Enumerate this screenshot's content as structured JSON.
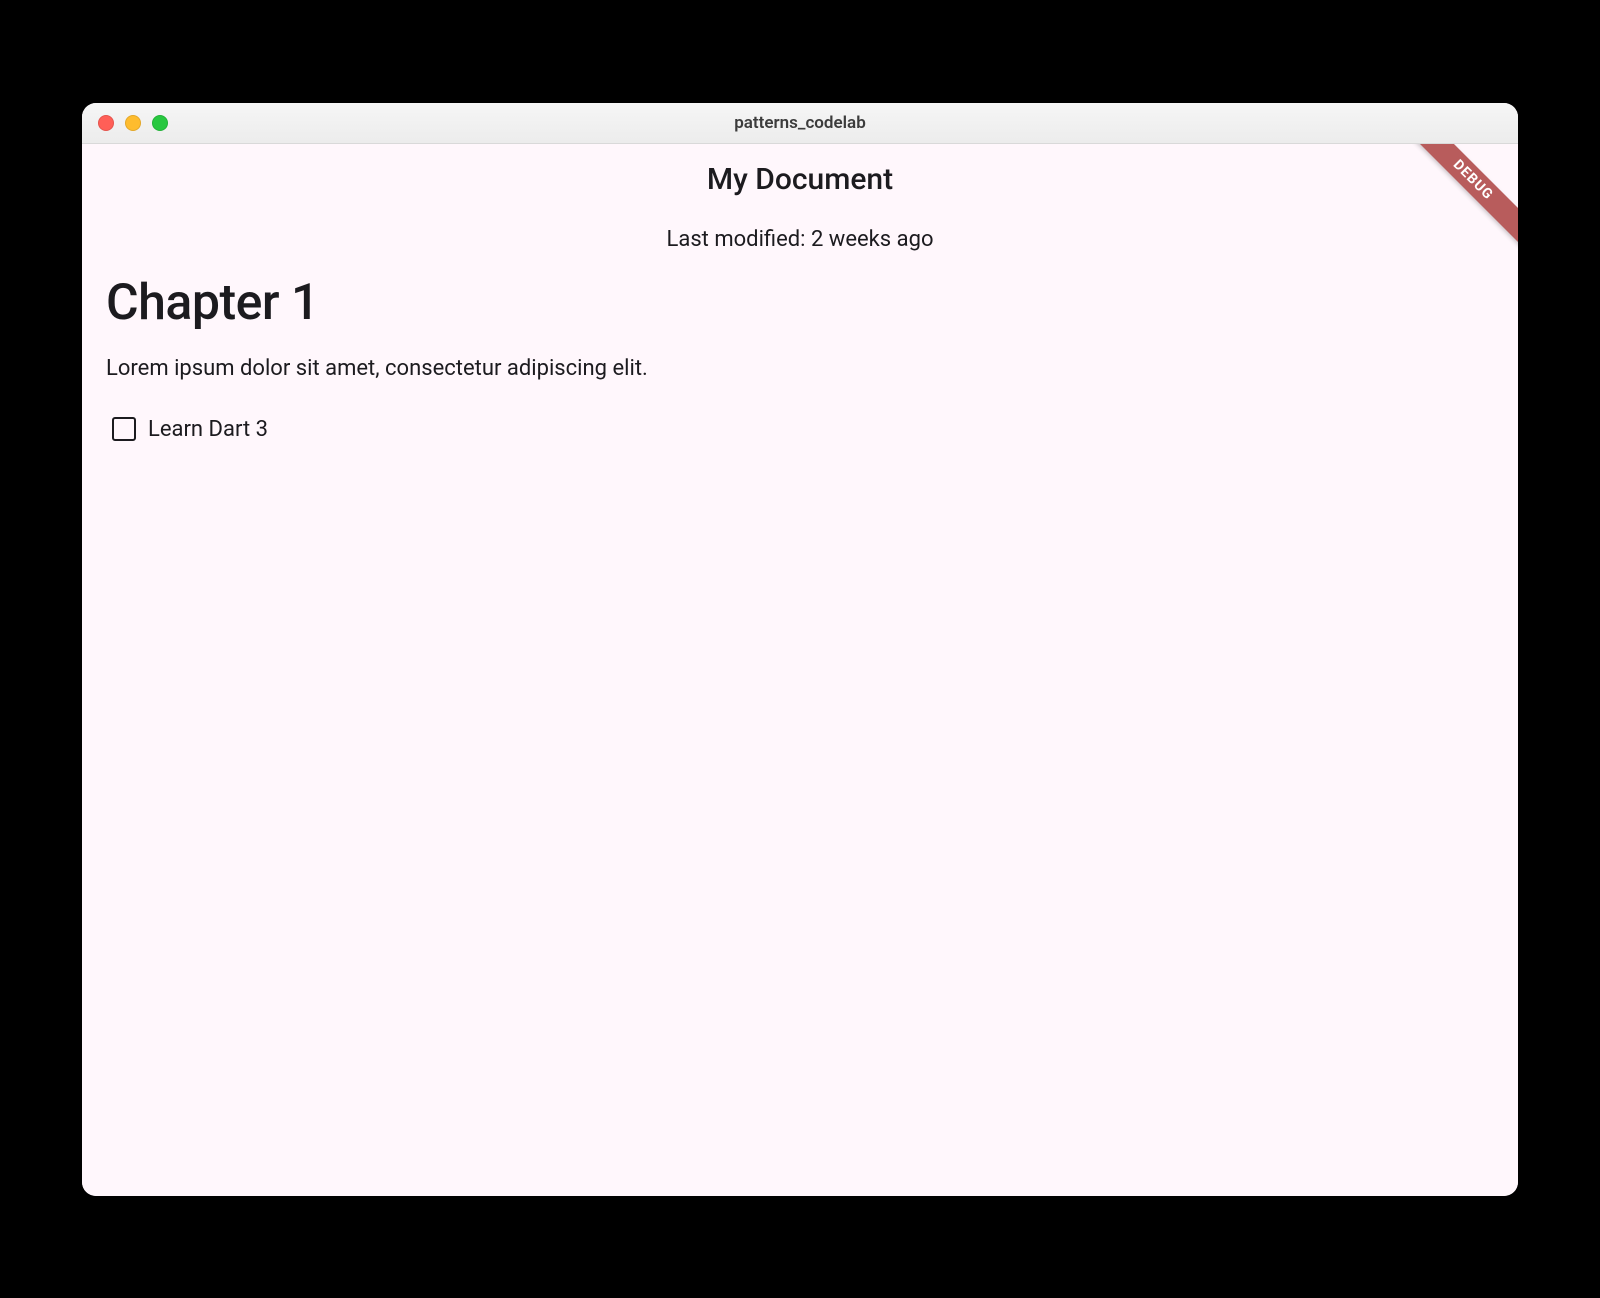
{
  "window": {
    "title": "patterns_codelab"
  },
  "header": {
    "page_title": "My Document",
    "subtitle": "Last modified: 2 weeks ago"
  },
  "body": {
    "heading": "Chapter 1",
    "paragraph": "Lorem ipsum dolor sit amet, consectetur adipiscing elit.",
    "checkbox": {
      "checked": false,
      "label": "Learn Dart 3"
    }
  },
  "debug_banner": "DEBUG",
  "icons": {
    "close": "close-icon",
    "minimize": "minimize-icon",
    "maximize": "maximize-icon",
    "checkbox": "checkbox-outline-icon"
  }
}
